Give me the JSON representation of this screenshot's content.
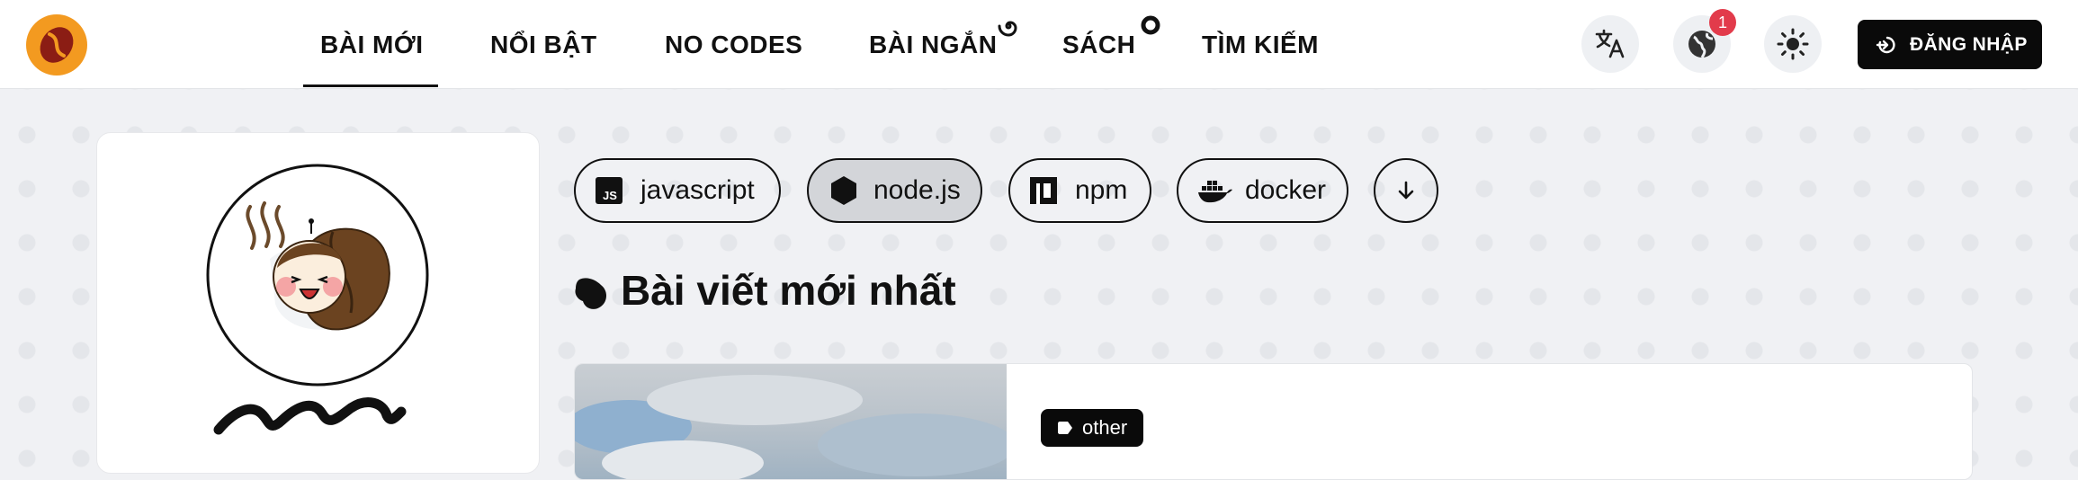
{
  "header": {
    "nav": [
      {
        "label": "BÀI MỚI",
        "active": true
      },
      {
        "label": "NỔI BẬT"
      },
      {
        "label": "NO CODES"
      },
      {
        "label": "BÀI NGẮN"
      },
      {
        "label": "SÁCH"
      },
      {
        "label": "TÌM KIẾM"
      }
    ],
    "notification_count": "1",
    "login_label": "ĐĂNG NHẬP"
  },
  "tags": [
    {
      "label": "javascript",
      "icon": "js-icon",
      "active": false
    },
    {
      "label": "node.js",
      "icon": "hexagon-icon",
      "active": true
    },
    {
      "label": "npm",
      "icon": "npm-icon",
      "active": false
    },
    {
      "label": "docker",
      "icon": "docker-icon",
      "active": false
    }
  ],
  "section": {
    "title": "Bài viết mới nhất"
  },
  "post": {
    "category": "other"
  },
  "colors": {
    "accent": "#f39a20",
    "badge": "#e23b4b",
    "dark": "#0a0a0a"
  }
}
